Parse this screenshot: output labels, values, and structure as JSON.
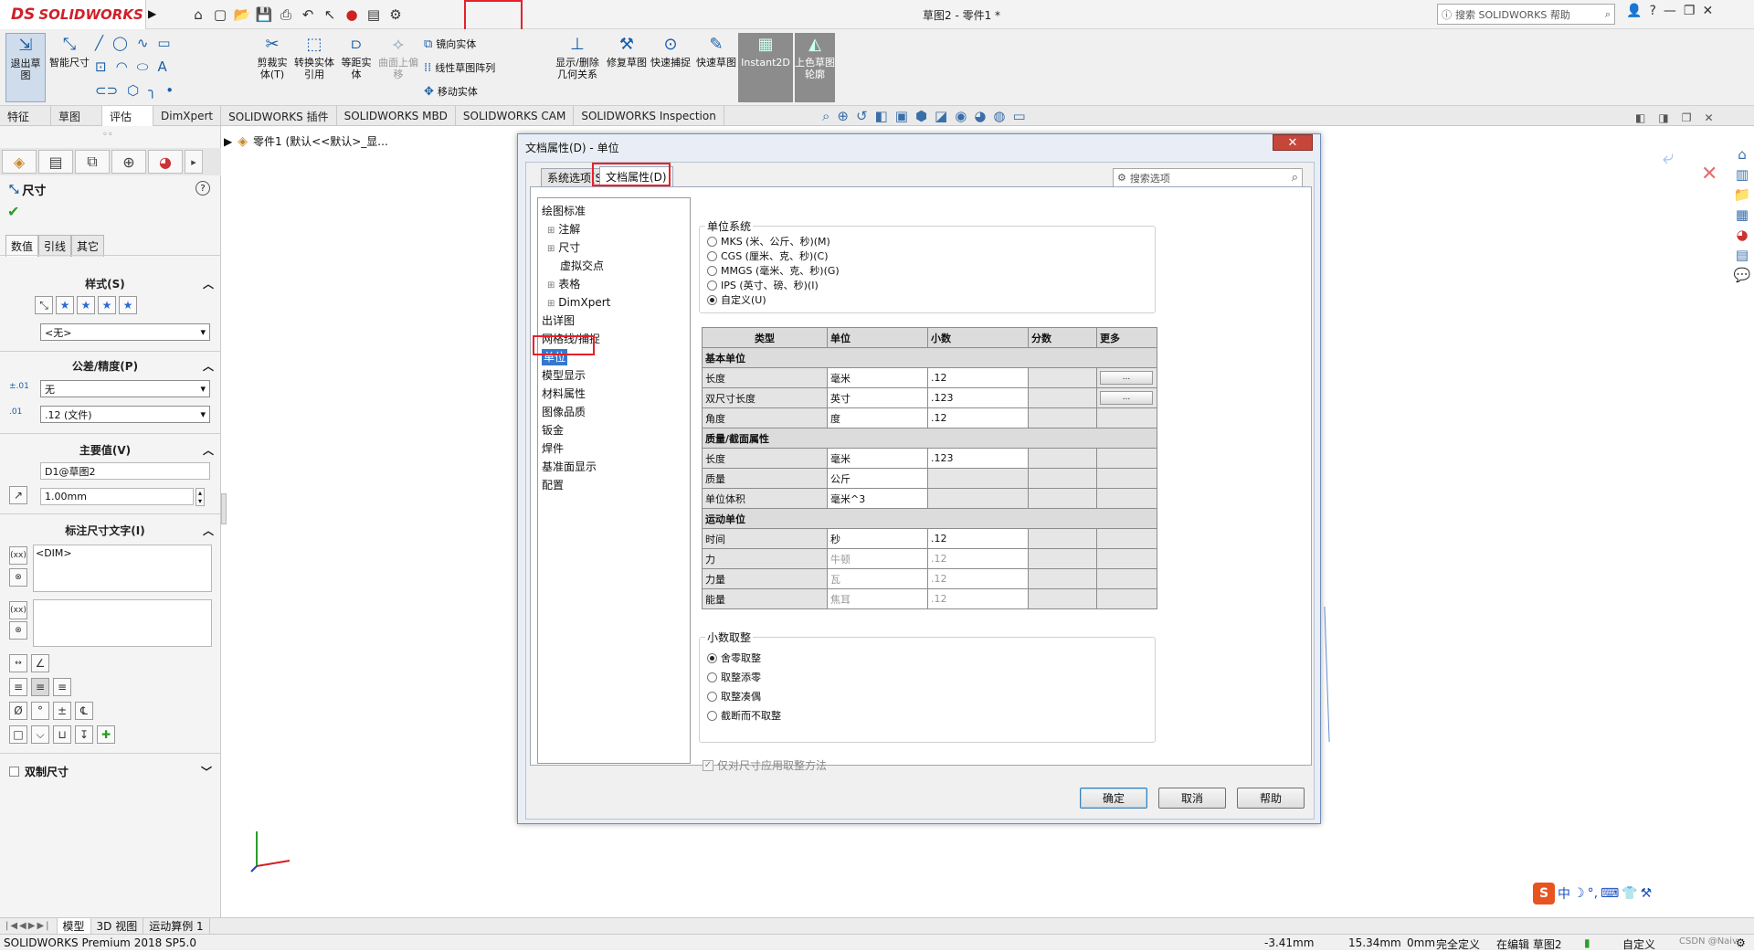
{
  "app": {
    "logo_ds": "DS",
    "logo_name": "SOLIDWORKS",
    "window_title": "草图2 - 零件1 *",
    "help_search_placeholder": "搜索 SOLIDWORKS 帮助"
  },
  "ribbon": {
    "exit_sketch": "退出草图",
    "smart_dim": "智能尺寸",
    "trim": "剪裁实体(T)",
    "convert": "转换实体引用",
    "offset": "等距实体",
    "surface_offset": "曲面上偏移",
    "mirror": "镜向实体",
    "linear_pattern": "线性草图阵列",
    "move": "移动实体",
    "show_relations": "显示/删除几何关系",
    "repair": "修复草图",
    "quick_snap": "快速捕捉",
    "rapid_sketch": "快速草图",
    "instant2d": "Instant2D",
    "shaded": "上色草图轮廓"
  },
  "tabs": [
    "特征",
    "草图",
    "评估",
    "DimXpert",
    "SOLIDWORKS 插件",
    "SOLIDWORKS MBD",
    "SOLIDWORKS CAM",
    "SOLIDWORKS Inspection"
  ],
  "active_tab_index": 2,
  "property_manager": {
    "title": "尺寸",
    "subtabs": [
      "数值",
      "引线",
      "其它"
    ],
    "style_label": "样式(S)",
    "style_value": "<无>",
    "tolerance_label": "公差/精度(P)",
    "tolerance_value": "无",
    "precision_value": ".12 (文件)",
    "primary_label": "主要值(V)",
    "primary_name": "D1@草图2",
    "primary_value": "1.00mm",
    "dim_text_label": "标注尺寸文字(I)",
    "dim_text": "<DIM>",
    "dual_label": "双制尺寸"
  },
  "feature_tree": {
    "root": "零件1 (默认<<默认>_显..."
  },
  "dialog": {
    "title": "文档属性(D) - 单位",
    "tab_system": "系统选项(S)",
    "tab_document": "文档属性(D)",
    "search_placeholder": "搜索选项",
    "tree": [
      "绘图标准",
      "注解",
      "尺寸",
      "虚拟交点",
      "表格",
      "DimXpert",
      "出详图",
      "网格线/捕捉",
      "单位",
      "模型显示",
      "材料属性",
      "图像品质",
      "钣金",
      "焊件",
      "基准面显示",
      "配置"
    ],
    "tree_selected": "单位",
    "unit_system_label": "单位系统",
    "unit_systems": [
      "MKS (米、公斤、秒)(M)",
      "CGS (厘米、克、秒)(C)",
      "MMGS (毫米、克、秒)(G)",
      "IPS (英寸、磅、秒)(I)",
      "自定义(U)"
    ],
    "unit_system_selected": 4,
    "table_headers": [
      "类型",
      "单位",
      "小数",
      "分数",
      "更多"
    ],
    "sections": [
      {
        "name": "基本单位",
        "rows": [
          [
            "长度",
            "毫米",
            ".12",
            "",
            "..."
          ],
          [
            "双尺寸长度",
            "英寸",
            ".123",
            "",
            "..."
          ],
          [
            "角度",
            "度",
            ".12",
            "",
            ""
          ]
        ]
      },
      {
        "name": "质量/截面属性",
        "rows": [
          [
            "长度",
            "毫米",
            ".123",
            "",
            ""
          ],
          [
            "质量",
            "公斤",
            "",
            "",
            ""
          ],
          [
            "单位体积",
            "毫米^3",
            "",
            "",
            ""
          ]
        ]
      },
      {
        "name": "运动单位",
        "rows": [
          [
            "时间",
            "秒",
            ".12",
            "",
            ""
          ],
          [
            "力",
            "牛顿",
            ".12",
            "",
            ""
          ],
          [
            "力量",
            "瓦",
            ".12",
            "",
            ""
          ],
          [
            "能量",
            "焦耳",
            ".12",
            "",
            ""
          ]
        ]
      }
    ],
    "rounding_label": "小数取整",
    "rounding_options": [
      "舍零取整",
      "取整添零",
      "取整凑偶",
      "截断而不取整"
    ],
    "rounding_selected": 0,
    "only_dim_check": "仅对尺寸应用取整方法",
    "ok": "确定",
    "cancel": "取消",
    "help": "帮助"
  },
  "bottom_tabs": [
    "模型",
    "3D 视图",
    "运动算例 1"
  ],
  "status": {
    "product": "SOLIDWORKS Premium 2018 SP5.0",
    "x": "-3.41mm",
    "y": "15.34mm",
    "z": "0mm",
    "defined": "完全定义",
    "editing": "在编辑 草图2",
    "units": "自定义",
    "watermark": "CSDN @Naiv"
  },
  "colors": {
    "accent": "#d0202a",
    "selection": "#3478d0",
    "highlight_box": "#e8202a"
  }
}
